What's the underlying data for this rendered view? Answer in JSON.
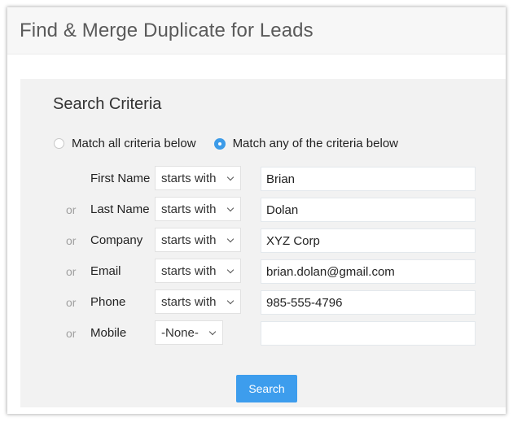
{
  "dialog": {
    "title": "Find & Merge Duplicate for Leads"
  },
  "search_criteria": {
    "title": "Search Criteria",
    "match_options": [
      {
        "label": "Match all criteria below",
        "selected": false
      },
      {
        "label": "Match any of the criteria below",
        "selected": true
      }
    ],
    "connector": "or",
    "rows": [
      {
        "connector": "",
        "field": "First Name",
        "operator": "starts with",
        "value": "Brian"
      },
      {
        "connector": "or",
        "field": "Last Name",
        "operator": "starts with",
        "value": "Dolan"
      },
      {
        "connector": "or",
        "field": "Company",
        "operator": "starts with",
        "value": "XYZ Corp"
      },
      {
        "connector": "or",
        "field": "Email",
        "operator": "starts with",
        "value": "brian.dolan@gmail.com"
      },
      {
        "connector": "or",
        "field": "Phone",
        "operator": "starts with",
        "value": "985-555-4796"
      },
      {
        "connector": "or",
        "field": "Mobile",
        "operator": "-None-",
        "value": ""
      }
    ],
    "search_button": "Search"
  },
  "colors": {
    "accent": "#3d9ded",
    "panel_bg": "#f2f2f2",
    "header_bg": "#f7f7f7"
  }
}
